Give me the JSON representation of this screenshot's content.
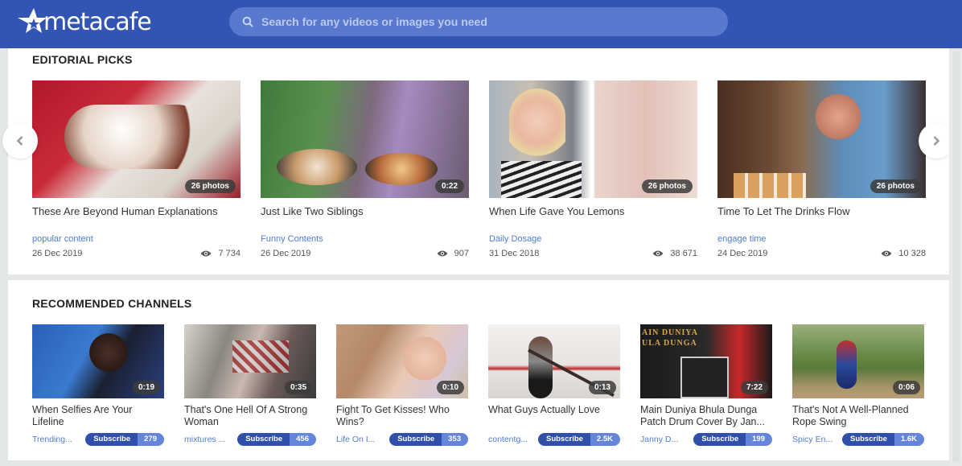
{
  "header": {
    "logo_text": "metacafe",
    "search_placeholder": "Search for any videos or images you need",
    "brand_color": "#3255b4"
  },
  "editorial": {
    "title": "EDITORIAL PICKS",
    "prev_icon": "chevron-left-icon",
    "next_icon": "chevron-right-icon",
    "cards": [
      {
        "title": "These Are Beyond Human Explanations",
        "badge": "26 photos",
        "category": "popular content",
        "date": "26 Dec 2019",
        "views": "7 734"
      },
      {
        "title": "Just Like Two Siblings",
        "badge": "0:22",
        "category": "Funny Contents",
        "date": "26 Dec 2019",
        "views": "907"
      },
      {
        "title": "When Life Gave You Lemons",
        "badge": "26 photos",
        "category": "Daily Dosage",
        "date": "31 Dec 2018",
        "views": "38 671"
      },
      {
        "title": "Time To Let The Drinks Flow",
        "badge": "26 photos",
        "category": "engage time",
        "date": "24 Dec 2019",
        "views": "10 328"
      }
    ]
  },
  "channels": {
    "title": "RECOMMENDED CHANNELS",
    "subscribe_label": "Subscribe",
    "items": [
      {
        "title": "When Selfies Are Your Lifeline",
        "duration": "0:19",
        "channel": "Trending...",
        "count": "279"
      },
      {
        "title": "That's One Hell Of A Strong Woman",
        "duration": "0:35",
        "channel": "mixtures ...",
        "count": "456"
      },
      {
        "title": "Fight To Get Kisses! Who Wins?",
        "duration": "0:10",
        "channel": "Life On I...",
        "count": "353"
      },
      {
        "title": "What Guys Actually Love",
        "duration": "0:13",
        "channel": "contentg...",
        "count": "2.5K"
      },
      {
        "title": "Main Duniya Bhula Dunga Patch Drum Cover By Jan...",
        "duration": "7:22",
        "channel": "Janny D...",
        "count": "199"
      },
      {
        "title": "That's Not A Well-Planned Rope Swing",
        "duration": "0:06",
        "channel": "Spicy En...",
        "count": "1.6K"
      }
    ]
  }
}
